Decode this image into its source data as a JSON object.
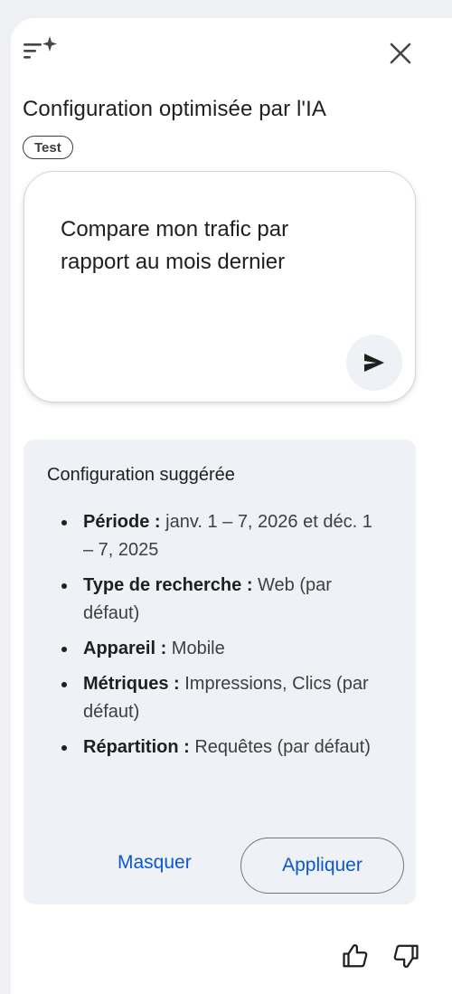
{
  "header": {
    "ai_icon": "sparkle-filter-icon",
    "close_icon": "close-icon",
    "title": "Configuration optimisée par l'IA",
    "badge": "Test"
  },
  "prompt": {
    "text": "Compare mon trafic par rapport au mois dernier",
    "send_icon": "send-icon"
  },
  "suggestion": {
    "title": "Configuration suggérée",
    "items": [
      {
        "label": "Période :",
        "value": " janv. 1 – 7, 2026 et déc. 1 – 7, 2025"
      },
      {
        "label": "Type de recherche :",
        "value": " Web (par défaut)"
      },
      {
        "label": "Appareil :",
        "value": " Mobile"
      },
      {
        "label": "Métriques :",
        "value": " Impressions, Clics (par défaut)"
      },
      {
        "label": "Répartition :",
        "value": " Requêtes (par défaut)"
      }
    ],
    "hide_label": "Masquer",
    "apply_label": "Appliquer"
  },
  "feedback": {
    "thumbs_up_icon": "thumbs-up-icon",
    "thumbs_down_icon": "thumbs-down-icon"
  },
  "colors": {
    "page_bg": "#eef0f3",
    "card_bg": "#eef1f5",
    "link_blue": "#0b57d0"
  }
}
